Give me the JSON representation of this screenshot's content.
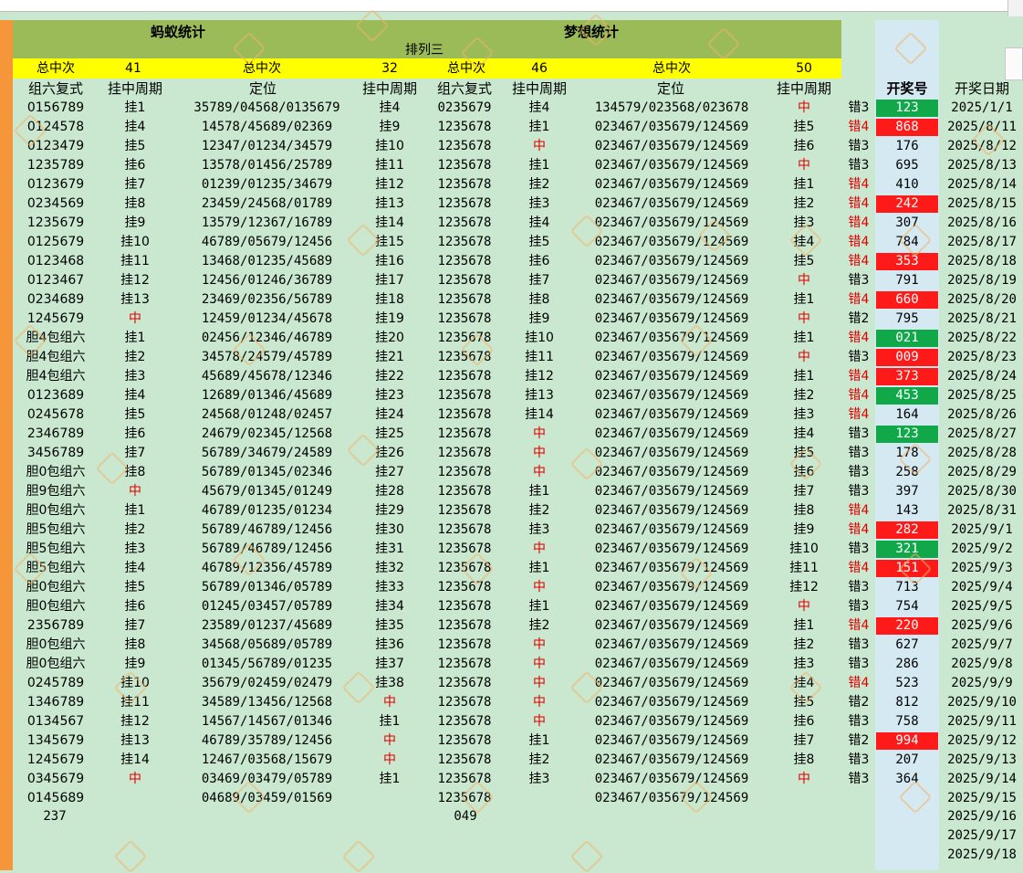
{
  "header": {
    "left_title": "蚂蚁统计",
    "right_title": "梦想统计",
    "subtitle": "排列三"
  },
  "summary": [
    {
      "label": "总中次",
      "value": "41"
    },
    {
      "label": "总中次",
      "value": "32"
    },
    {
      "label": "总中次",
      "value": "46"
    },
    {
      "label": "总中次",
      "value": "50"
    }
  ],
  "columns": [
    "组六复式",
    "挂中周期",
    "定位",
    "挂中周期",
    "组六复式",
    "挂中周期",
    "定位",
    "挂中周期",
    "开奖号",
    "开奖日期"
  ],
  "rows": [
    [
      "0156789",
      "挂1",
      "35789/04568/0135679",
      "挂4",
      "0235679",
      "挂4",
      "134579/023568/023678",
      "中",
      "错3",
      "123",
      "2025/1/1"
    ],
    [
      "0124578",
      "挂4",
      "14578/45689/02369",
      "挂9",
      "1235678",
      "挂1",
      "023467/035679/124569",
      "挂5",
      "错4",
      "868",
      "2025/8/11"
    ],
    [
      "0123479",
      "挂5",
      "12347/01234/34579",
      "挂10",
      "1235678",
      "中",
      "023467/035679/124569",
      "挂6",
      "错3",
      "176",
      "2025/8/12"
    ],
    [
      "1235789",
      "挂6",
      "13578/01456/25789",
      "挂11",
      "1235678",
      "挂1",
      "023467/035679/124569",
      "中",
      "错3",
      "695",
      "2025/8/13"
    ],
    [
      "0123679",
      "挂7",
      "01239/01235/34679",
      "挂12",
      "1235678",
      "挂2",
      "023467/035679/124569",
      "挂1",
      "错4",
      "410",
      "2025/8/14"
    ],
    [
      "0234569",
      "挂8",
      "23459/24568/01789",
      "挂13",
      "1235678",
      "挂3",
      "023467/035679/124569",
      "挂2",
      "错4",
      "242",
      "2025/8/15"
    ],
    [
      "1235679",
      "挂9",
      "13579/12367/16789",
      "挂14",
      "1235678",
      "挂4",
      "023467/035679/124569",
      "挂3",
      "错4",
      "307",
      "2025/8/16"
    ],
    [
      "0125679",
      "挂10",
      "46789/05679/12456",
      "挂15",
      "1235678",
      "挂5",
      "023467/035679/124569",
      "挂4",
      "错4",
      "784",
      "2025/8/17"
    ],
    [
      "0123468",
      "挂11",
      "13468/01235/45689",
      "挂16",
      "1235678",
      "挂6",
      "023467/035679/124569",
      "挂5",
      "错4",
      "353",
      "2025/8/18"
    ],
    [
      "0123467",
      "挂12",
      "12456/01246/36789",
      "挂17",
      "1235678",
      "挂7",
      "023467/035679/124569",
      "中",
      "错3",
      "791",
      "2025/8/19"
    ],
    [
      "0234689",
      "挂13",
      "23469/02356/56789",
      "挂18",
      "1235678",
      "挂8",
      "023467/035679/124569",
      "挂1",
      "错4",
      "660",
      "2025/8/20"
    ],
    [
      "1245679",
      "中",
      "12459/01234/45678",
      "挂19",
      "1235678",
      "挂9",
      "023467/035679/124569",
      "中",
      "错2",
      "795",
      "2025/8/21"
    ],
    [
      "胆4包组六",
      "挂1",
      "02456/12346/46789",
      "挂20",
      "1235678",
      "挂10",
      "023467/035679/124569",
      "挂1",
      "错4",
      "021",
      "2025/8/22"
    ],
    [
      "胆4包组六",
      "挂2",
      "34578/24579/45789",
      "挂21",
      "1235678",
      "挂11",
      "023467/035679/124569",
      "中",
      "错3",
      "009",
      "2025/8/23"
    ],
    [
      "胆4包组六",
      "挂3",
      "45689/45678/12346",
      "挂22",
      "1235678",
      "挂12",
      "023467/035679/124569",
      "挂1",
      "错4",
      "373",
      "2025/8/24"
    ],
    [
      "0123689",
      "挂4",
      "12689/01346/45689",
      "挂23",
      "1235678",
      "挂13",
      "023467/035679/124569",
      "挂2",
      "错4",
      "453",
      "2025/8/25"
    ],
    [
      "0245678",
      "挂5",
      "24568/01248/02457",
      "挂24",
      "1235678",
      "挂14",
      "023467/035679/124569",
      "挂3",
      "错4",
      "164",
      "2025/8/26"
    ],
    [
      "2346789",
      "挂6",
      "24679/02345/12568",
      "挂25",
      "1235678",
      "中",
      "023467/035679/124569",
      "挂4",
      "错3",
      "123",
      "2025/8/27"
    ],
    [
      "3456789",
      "挂7",
      "56789/34679/24589",
      "挂26",
      "1235678",
      "中",
      "023467/035679/124569",
      "挂5",
      "错3",
      "178",
      "2025/8/28"
    ],
    [
      "胆0包组六",
      "挂8",
      "56789/01345/02346",
      "挂27",
      "1235678",
      "中",
      "023467/035679/124569",
      "挂6",
      "错3",
      "258",
      "2025/8/29"
    ],
    [
      "胆9包组六",
      "中",
      "45679/01345/01249",
      "挂28",
      "1235678",
      "挂1",
      "023467/035679/124569",
      "挂7",
      "错3",
      "397",
      "2025/8/30"
    ],
    [
      "胆0包组六",
      "挂1",
      "46789/01235/01234",
      "挂29",
      "1235678",
      "挂2",
      "023467/035679/124569",
      "挂8",
      "错4",
      "143",
      "2025/8/31"
    ],
    [
      "胆5包组六",
      "挂2",
      "56789/46789/12456",
      "挂30",
      "1235678",
      "挂3",
      "023467/035679/124569",
      "挂9",
      "错4",
      "282",
      "2025/9/1"
    ],
    [
      "胆5包组六",
      "挂3",
      "56789/46789/12456",
      "挂31",
      "1235678",
      "中",
      "023467/035679/124569",
      "挂10",
      "错3",
      "321",
      "2025/9/2"
    ],
    [
      "胆5包组六",
      "挂4",
      "46789/12356/45789",
      "挂32",
      "1235678",
      "挂1",
      "023467/035679/124569",
      "挂11",
      "错4",
      "151",
      "2025/9/3"
    ],
    [
      "胆0包组六",
      "挂5",
      "56789/01346/05789",
      "挂33",
      "1235678",
      "中",
      "023467/035679/124569",
      "挂12",
      "错3",
      "713",
      "2025/9/4"
    ],
    [
      "胆0包组六",
      "挂6",
      "01245/03457/05789",
      "挂34",
      "1235678",
      "挂1",
      "023467/035679/124569",
      "中",
      "错3",
      "754",
      "2025/9/5"
    ],
    [
      "2356789",
      "挂7",
      "23589/01237/45689",
      "挂35",
      "1235678",
      "挂2",
      "023467/035679/124569",
      "挂1",
      "错4",
      "220",
      "2025/9/6"
    ],
    [
      "胆0包组六",
      "挂8",
      "34568/05689/05789",
      "挂36",
      "1235678",
      "中",
      "023467/035679/124569",
      "挂2",
      "错3",
      "627",
      "2025/9/7"
    ],
    [
      "胆0包组六",
      "挂9",
      "01345/56789/01235",
      "挂37",
      "1235678",
      "中",
      "023467/035679/124569",
      "挂3",
      "错3",
      "286",
      "2025/9/8"
    ],
    [
      "0245789",
      "挂10",
      "35679/02459/02479",
      "挂38",
      "1235678",
      "中",
      "023467/035679/124569",
      "挂4",
      "错4",
      "523",
      "2025/9/9"
    ],
    [
      "1346789",
      "挂11",
      "34589/13456/12568",
      "中",
      "1235678",
      "中",
      "023467/035679/124569",
      "挂5",
      "错2",
      "812",
      "2025/9/10"
    ],
    [
      "0134567",
      "挂12",
      "14567/14567/01346",
      "挂1",
      "1235678",
      "中",
      "023467/035679/124569",
      "挂6",
      "错3",
      "758",
      "2025/9/11"
    ],
    [
      "1345679",
      "挂13",
      "46789/35789/12456",
      "中",
      "1235678",
      "挂1",
      "023467/035679/124569",
      "挂7",
      "错2",
      "994",
      "2025/9/12"
    ],
    [
      "1245679",
      "挂14",
      "12467/03568/15679",
      "中",
      "1235678",
      "挂2",
      "023467/035679/124569",
      "挂8",
      "错3",
      "207",
      "2025/9/13"
    ],
    [
      "0345679",
      "中",
      "03469/03479/05789",
      "挂1",
      "1235678",
      "挂3",
      "023467/035679/124569",
      "中",
      "错3",
      "364",
      "2025/9/14"
    ],
    [
      "0145689",
      "",
      "04689/03459/01569",
      "",
      "1235678",
      "",
      "023467/035679/124569",
      "",
      "",
      "",
      "2025/9/15"
    ]
  ],
  "row_styles": {
    "0": {
      "kj": "green"
    },
    "1": {
      "kj": "red"
    },
    "5": {
      "kj": "red"
    },
    "8": {
      "kj": "red"
    },
    "10": {
      "kj": "red"
    },
    "12": {
      "kj": "green"
    },
    "13": {
      "kj": "red"
    },
    "14": {
      "kj": "red"
    },
    "15": {
      "kj": "green"
    },
    "17": {
      "kj": "green"
    },
    "22": {
      "kj": "red"
    },
    "23": {
      "kj": "green"
    },
    "24": {
      "kj": "red"
    },
    "27": {
      "kj": "red"
    },
    "33": {
      "kj": "red"
    }
  },
  "totals": {
    "left": "237",
    "mid": "049"
  },
  "extra_dates": [
    "2025/9/16",
    "2025/9/17",
    "2025/9/18"
  ],
  "colors": {
    "red": "#ff1a1a",
    "green": "#11a84a",
    "yellow": "#ffff00",
    "header": "#9bbb59",
    "text_red": "#e00000"
  }
}
